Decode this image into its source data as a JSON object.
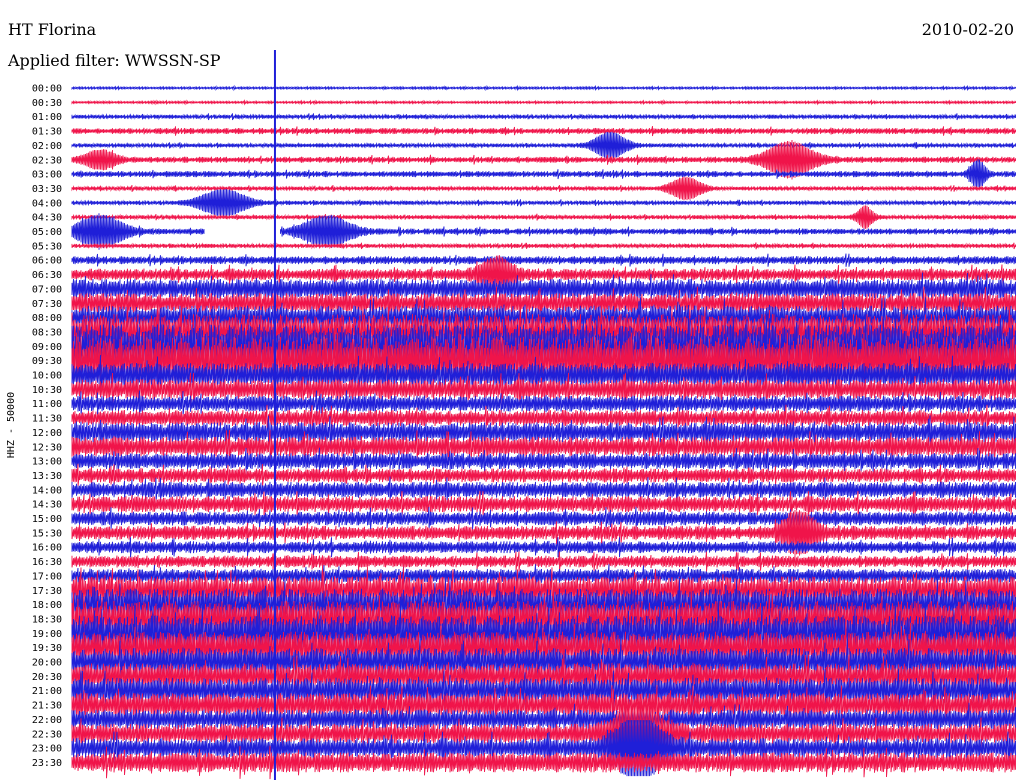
{
  "header": {
    "station": "HT Florina",
    "date": "2010-02-20",
    "filter": "Applied filter: WWSSN-SP"
  },
  "chart_data": {
    "type": "line",
    "title": "HT Florina",
    "date": "2010-02-20",
    "filter": "WWSSN-SP",
    "ylabel": "HHZ - 50000",
    "rows": [
      "00:00",
      "00:30",
      "01:00",
      "01:30",
      "02:00",
      "02:30",
      "03:00",
      "03:30",
      "04:00",
      "04:30",
      "05:00",
      "05:30",
      "06:00",
      "06:30",
      "07:00",
      "07:30",
      "08:00",
      "08:30",
      "09:00",
      "09:30",
      "10:00",
      "10:30",
      "11:00",
      "11:30",
      "12:00",
      "12:30",
      "13:00",
      "13:30",
      "14:00",
      "14:30",
      "15:00",
      "15:30",
      "16:00",
      "16:30",
      "17:00",
      "17:30",
      "18:00",
      "18:30",
      "19:00",
      "19:30",
      "20:00",
      "20:30",
      "21:00",
      "21:30",
      "22:00",
      "22:30",
      "23:00",
      "23:30"
    ],
    "series_colors": [
      "#1f1fd8",
      "#f0144a"
    ],
    "noise_level": [
      1,
      1,
      2,
      3,
      2,
      3,
      3,
      2,
      2,
      2,
      3,
      2,
      4,
      6,
      10,
      10,
      12,
      18,
      22,
      24,
      12,
      10,
      8,
      8,
      10,
      10,
      8,
      7,
      8,
      8,
      7,
      7,
      6,
      6,
      7,
      14,
      16,
      18,
      18,
      16,
      14,
      13,
      13,
      12,
      10,
      10,
      10,
      10
    ],
    "events": [
      {
        "row": "02:00",
        "x": 0.57,
        "amp": 12,
        "width": 0.02
      },
      {
        "row": "02:30",
        "x": 0.76,
        "amp": 16,
        "width": 0.03
      },
      {
        "row": "02:30",
        "x": 0.03,
        "amp": 8,
        "width": 0.02
      },
      {
        "row": "03:00",
        "x": 0.96,
        "amp": 12,
        "width": 0.01
      },
      {
        "row": "03:30",
        "x": 0.65,
        "amp": 10,
        "width": 0.02
      },
      {
        "row": "04:00",
        "x": 0.16,
        "amp": 12,
        "width": 0.03
      },
      {
        "row": "04:30",
        "x": 0.84,
        "amp": 10,
        "width": 0.01
      },
      {
        "row": "05:00",
        "x": 0.03,
        "amp": 14,
        "width": 0.03
      },
      {
        "row": "05:00",
        "x": 0.27,
        "amp": 14,
        "width": 0.03
      },
      {
        "row": "06:30",
        "x": 0.45,
        "amp": 14,
        "width": 0.02
      },
      {
        "row": "15:30",
        "x": 0.77,
        "amp": 18,
        "width": 0.02
      },
      {
        "row": "22:30",
        "x": 0.6,
        "amp": 24,
        "width": 0.03
      },
      {
        "row": "23:00",
        "x": 0.6,
        "amp": 26,
        "width": 0.03
      }
    ],
    "gaps": [
      {
        "row": "05:00",
        "from": 0.14,
        "to": 0.22
      }
    ],
    "marker_fraction": 0.215,
    "grid": false
  }
}
